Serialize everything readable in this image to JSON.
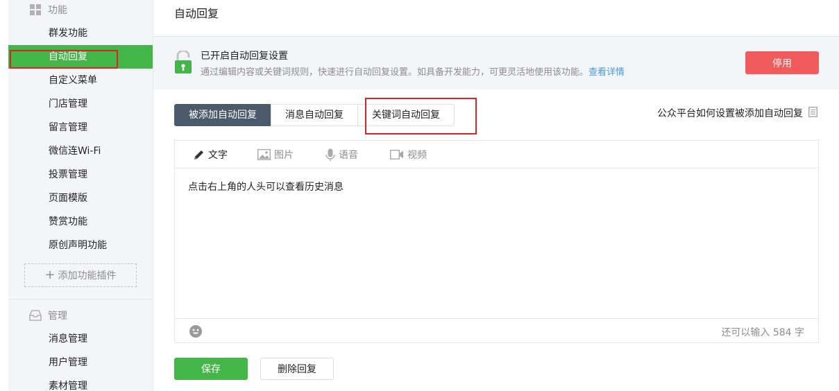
{
  "sidebar": {
    "section_function": "功能",
    "items_function": [
      {
        "label": "群发功能"
      },
      {
        "label": "自动回复"
      },
      {
        "label": "自定义菜单"
      },
      {
        "label": "门店管理"
      },
      {
        "label": "留言管理"
      },
      {
        "label": "微信连Wi-Fi"
      },
      {
        "label": "投票管理"
      },
      {
        "label": "页面模版"
      },
      {
        "label": "赞赏功能"
      },
      {
        "label": "原创声明功能"
      }
    ],
    "add_plugin": "添加功能插件",
    "section_manage": "管理",
    "items_manage": [
      {
        "label": "消息管理"
      },
      {
        "label": "用户管理"
      },
      {
        "label": "素材管理"
      }
    ],
    "active_item": "自动回复"
  },
  "main": {
    "page_title": "自动回复",
    "notice": {
      "title": "已开启自动回复设置",
      "desc": "通过编辑内容或关键词规则，快速进行自动回复设置。如具备开发能力，可更灵活地使用该功能。",
      "link": "查看详情",
      "disable_button": "停用"
    },
    "tabs": [
      {
        "label": "被添加自动回复"
      },
      {
        "label": "消息自动回复"
      },
      {
        "label": "关键词自动回复"
      }
    ],
    "help_link": "公众平台如何设置被添加自动回复",
    "editor": {
      "tools": [
        {
          "label": "文字",
          "icon": "pencil-icon"
        },
        {
          "label": "图片",
          "icon": "image-icon"
        },
        {
          "label": "语音",
          "icon": "microphone-icon"
        },
        {
          "label": "视频",
          "icon": "video-icon"
        }
      ],
      "content": "点击右上角的人头可以查看历史消息",
      "char_count": "还可以输入 584 字"
    },
    "save_button": "保存",
    "delete_button": "删除回复"
  },
  "colors": {
    "accent_green": "#44b549",
    "danger_red": "#f15b5b",
    "tab_active": "#4b596b",
    "link_blue": "#459ae9",
    "highlight_red_box": "#d9232a"
  }
}
